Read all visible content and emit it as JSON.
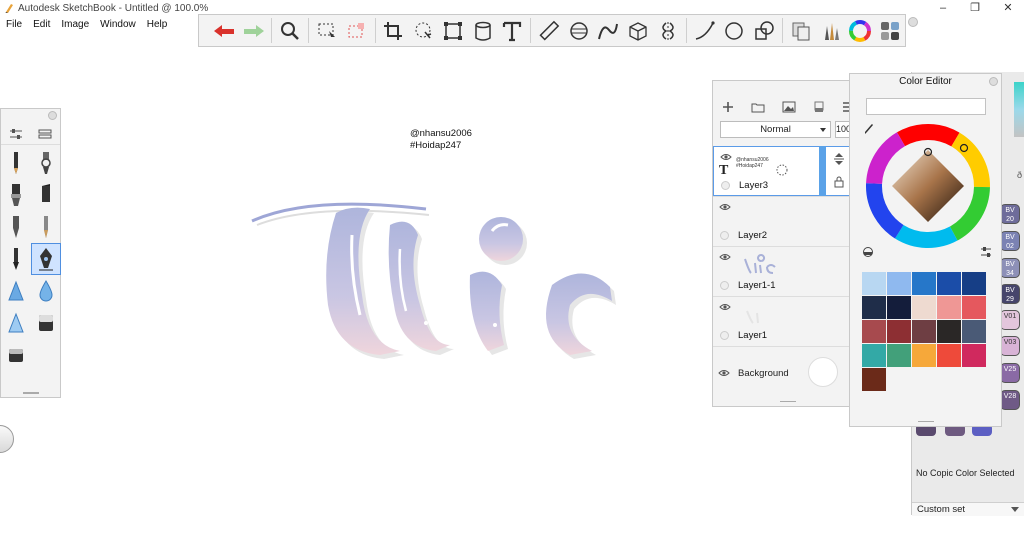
{
  "window": {
    "title": "Autodesk SketchBook - Untitled @ 100.0%",
    "minimize": "–",
    "maximize": "❐",
    "close": "✕"
  },
  "menu": [
    "File",
    "Edit",
    "Image",
    "Window",
    "Help"
  ],
  "toolbar": {
    "tools": [
      "undo-icon",
      "redo-icon",
      "zoom-icon",
      "select-icon",
      "crop-select-icon",
      "crop-icon",
      "lasso-icon",
      "transform-icon",
      "fill-icon",
      "text-icon",
      "ruler-icon",
      "ellipse-guide-icon",
      "curve-icon",
      "perspective-icon",
      "symmetry-icon",
      "stroke-icon",
      "circle-icon",
      "shape-icon",
      "copy-icon",
      "brush-library-icon",
      "color-wheel-icon",
      "palette-icon"
    ]
  },
  "canvas": {
    "watermark_line1": "@nhansu2006",
    "watermark_line2": "#Hoidap247"
  },
  "layers": {
    "blend_mode": "Normal",
    "opacity": "100",
    "items": [
      {
        "name": "Layer3",
        "thumb_text": "@nhansu2006 #Hoidap247"
      },
      {
        "name": "Layer2"
      },
      {
        "name": "Layer1-1"
      },
      {
        "name": "Layer1"
      },
      {
        "name": "Background"
      }
    ]
  },
  "color_editor": {
    "title": "Color Editor",
    "swatches": [
      "#b8d7f2",
      "#8fb9ef",
      "#2677c9",
      "#1b4da8",
      "#163e86",
      "#1f2d49",
      "#141d3b",
      "#eedad0",
      "#ef9795",
      "#e5585e",
      "#a74a4e",
      "#8d2f33",
      "#6e3e43",
      "#2a2726",
      "#4a5a76",
      "#33a9a6",
      "#42a07a",
      "#f6a83a",
      "#ee4a3a",
      "#d0295e",
      "#6b2a19"
    ]
  },
  "copic": {
    "swatch_labels": [
      "BV 20",
      "BV 02",
      "BV 34",
      "BV 29",
      "V01",
      "V03",
      "V25",
      "V28"
    ],
    "status": "No Copic Color Selected",
    "set_label": "Custom set",
    "partial_label": "ð"
  }
}
